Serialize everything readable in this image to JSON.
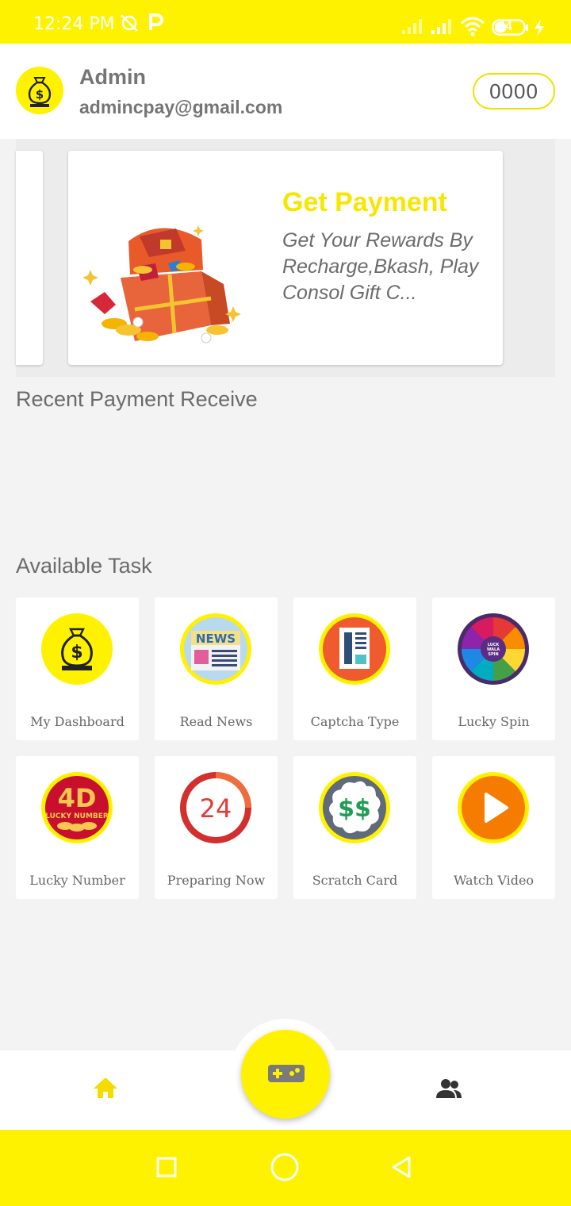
{
  "status_bar": {
    "time": "12:24 PM",
    "icons": [
      "alarm-off-icon",
      "p-icon",
      "signal-icon",
      "signal-icon",
      "wifi-icon",
      "battery-icon",
      "charging-icon"
    ],
    "battery_level": "34"
  },
  "header": {
    "avatar_icon": "money-bag-icon",
    "user_name": "Admin",
    "user_email": "admincpay@gmail.com",
    "balance": "0000"
  },
  "banner": {
    "title": "Get Payment",
    "description": "Get Your Rewards By Recharge,Bkash, Play Consol Gift C...",
    "image_icon": "treasure-chest-icon"
  },
  "sections": {
    "recent_payment": "Recent Payment Receive",
    "available_task": "Available Task"
  },
  "tasks": [
    {
      "label": "My Dashboard",
      "icon": "money-bag-icon"
    },
    {
      "label": "Read News",
      "icon": "news-icon"
    },
    {
      "label": "Captcha Type",
      "icon": "document-icon"
    },
    {
      "label": "Lucky Spin",
      "icon": "spin-wheel-icon"
    },
    {
      "label": "Lucky Number",
      "icon": "lucky-number-icon"
    },
    {
      "label": "Preparing Now",
      "icon": "clock-24-icon"
    },
    {
      "label": "Scratch Card",
      "icon": "dollar-badge-icon"
    },
    {
      "label": "Watch Video",
      "icon": "play-icon"
    }
  ],
  "icon_text": {
    "news": "NEWS",
    "clock": "24",
    "scratch": "$$",
    "lucky_number": "4D",
    "lucky_number_sub": "LUCKY NUMBER",
    "wheel": "LUCK WALA SPIN"
  },
  "bottom_nav": {
    "home_icon": "home-icon",
    "game_icon": "gamepad-icon",
    "people_icon": "people-icon"
  },
  "colors": {
    "brand_yellow": "#fff200",
    "title_yellow": "#f7e600",
    "text_gray": "#757575"
  }
}
